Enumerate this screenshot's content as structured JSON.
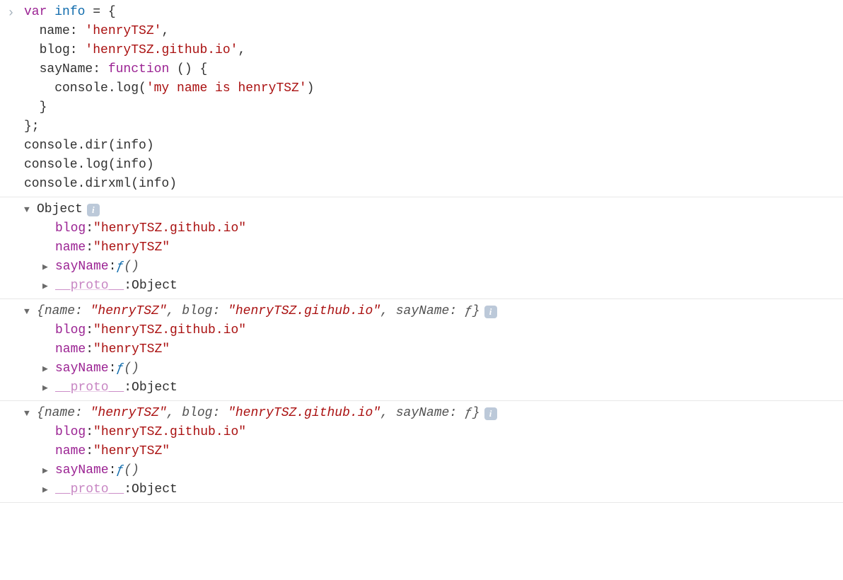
{
  "input": {
    "kw_var": "var",
    "ident": "info",
    "eq": " = ",
    "brace_open": "{",
    "line_name_key": "  name: ",
    "line_name_val": "'henryTSZ'",
    "comma": ",",
    "line_blog_key": "  blog: ",
    "line_blog_val": "'henryTSZ.github.io'",
    "line_sayname_key": "  sayName: ",
    "kw_function": "function",
    "fn_sig": " () {",
    "fn_body_prefix": "    console.log(",
    "fn_body_str": "'my name is henryTSZ'",
    "fn_body_suffix": ")",
    "fn_close": "  }",
    "obj_close": "};",
    "call1": "console.dir(info)",
    "call2": "console.log(info)",
    "call3": "console.dirxml(info)"
  },
  "output1": {
    "header": "Object",
    "blog_key": "blog",
    "blog_val": "\"henryTSZ.github.io\"",
    "name_key": "name",
    "name_val": "\"henryTSZ\"",
    "sayname_key": "sayName",
    "sayname_val_f": "ƒ ",
    "sayname_val_paren": "()",
    "proto_key": "__proto__",
    "proto_val": "Object"
  },
  "output2": {
    "header_pre": "{",
    "header_k1": "name: ",
    "header_v1": "\"henryTSZ\"",
    "header_sep": ", ",
    "header_k2": "blog: ",
    "header_v2": "\"henryTSZ.github.io\"",
    "header_k3": "sayName: ",
    "header_v3": "ƒ",
    "header_post": "}",
    "blog_key": "blog",
    "blog_val": "\"henryTSZ.github.io\"",
    "name_key": "name",
    "name_val": "\"henryTSZ\"",
    "sayname_key": "sayName",
    "sayname_val_f": "ƒ ",
    "sayname_val_paren": "()",
    "proto_key": "__proto__",
    "proto_val": "Object"
  },
  "output3": {
    "header_pre": "{",
    "header_k1": "name: ",
    "header_v1": "\"henryTSZ\"",
    "header_sep": ", ",
    "header_k2": "blog: ",
    "header_v2": "\"henryTSZ.github.io\"",
    "header_k3": "sayName: ",
    "header_v3": "ƒ",
    "header_post": "}",
    "blog_key": "blog",
    "blog_val": "\"henryTSZ.github.io\"",
    "name_key": "name",
    "name_val": "\"henryTSZ\"",
    "sayname_key": "sayName",
    "sayname_val_f": "ƒ ",
    "sayname_val_paren": "()",
    "proto_key": "__proto__",
    "proto_val": "Object"
  },
  "icons": {
    "info": "i"
  }
}
